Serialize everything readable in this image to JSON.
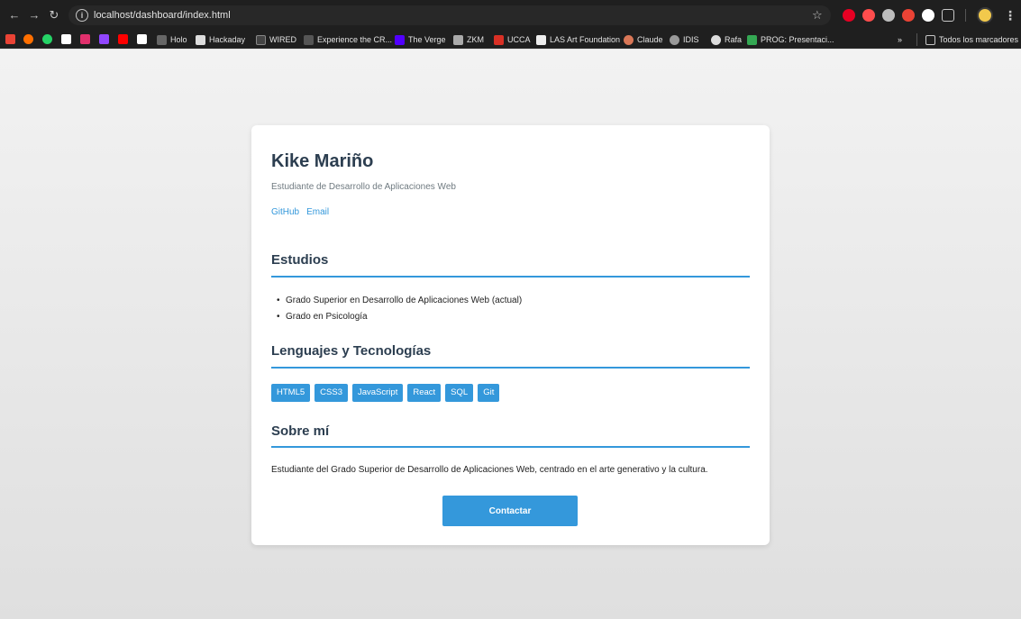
{
  "browser": {
    "url": "localhost/dashboard/index.html",
    "bookmarks": [
      {
        "label": "Holo",
        "color": "#666666"
      },
      {
        "label": "Hackaday",
        "color": "#dddddd"
      },
      {
        "label": "WIRED",
        "color": "#444444"
      },
      {
        "label": "Experience the CR...",
        "color": "#555555"
      },
      {
        "label": "The Verge",
        "color": "#5200ff"
      },
      {
        "label": "ZKM",
        "color": "#aaaaaa"
      },
      {
        "label": "UCCA",
        "color": "#d93025"
      },
      {
        "label": "LAS Art Foundation",
        "color": "#eeeeee"
      },
      {
        "label": "Claude",
        "color": "#d97757"
      },
      {
        "label": "IDIS",
        "color": "#999999"
      },
      {
        "label": "Rafa",
        "color": "#dddddd"
      },
      {
        "label": "PROG: Presentaci...",
        "color": "#34a853"
      }
    ],
    "overflow_label": "»",
    "all_bookmarks_label": "Todos los marcadores"
  },
  "profile": {
    "name": "Kike Mariño",
    "subtitle": "Estudiante de Desarrollo de Aplicaciones Web",
    "links": [
      "GitHub",
      "Email"
    ]
  },
  "studies": {
    "title": "Estudios",
    "items": [
      "Grado Superior en Desarrollo de Aplicaciones Web (actual)",
      "Grado en Psicología"
    ]
  },
  "tech": {
    "title": "Lenguajes y Tecnologías",
    "tags": [
      "HTML5",
      "CSS3",
      "JavaScript",
      "React",
      "SQL",
      "Git"
    ]
  },
  "about": {
    "title": "Sobre mí",
    "text": "Estudiante del Grado Superior de Desarrollo de Aplicaciones Web, centrado en el arte generativo y la cultura."
  },
  "contact_button": "Contactar",
  "colors": {
    "accent": "#3498db",
    "heading": "#2c3e50",
    "chrome": "#1f1f1f"
  }
}
